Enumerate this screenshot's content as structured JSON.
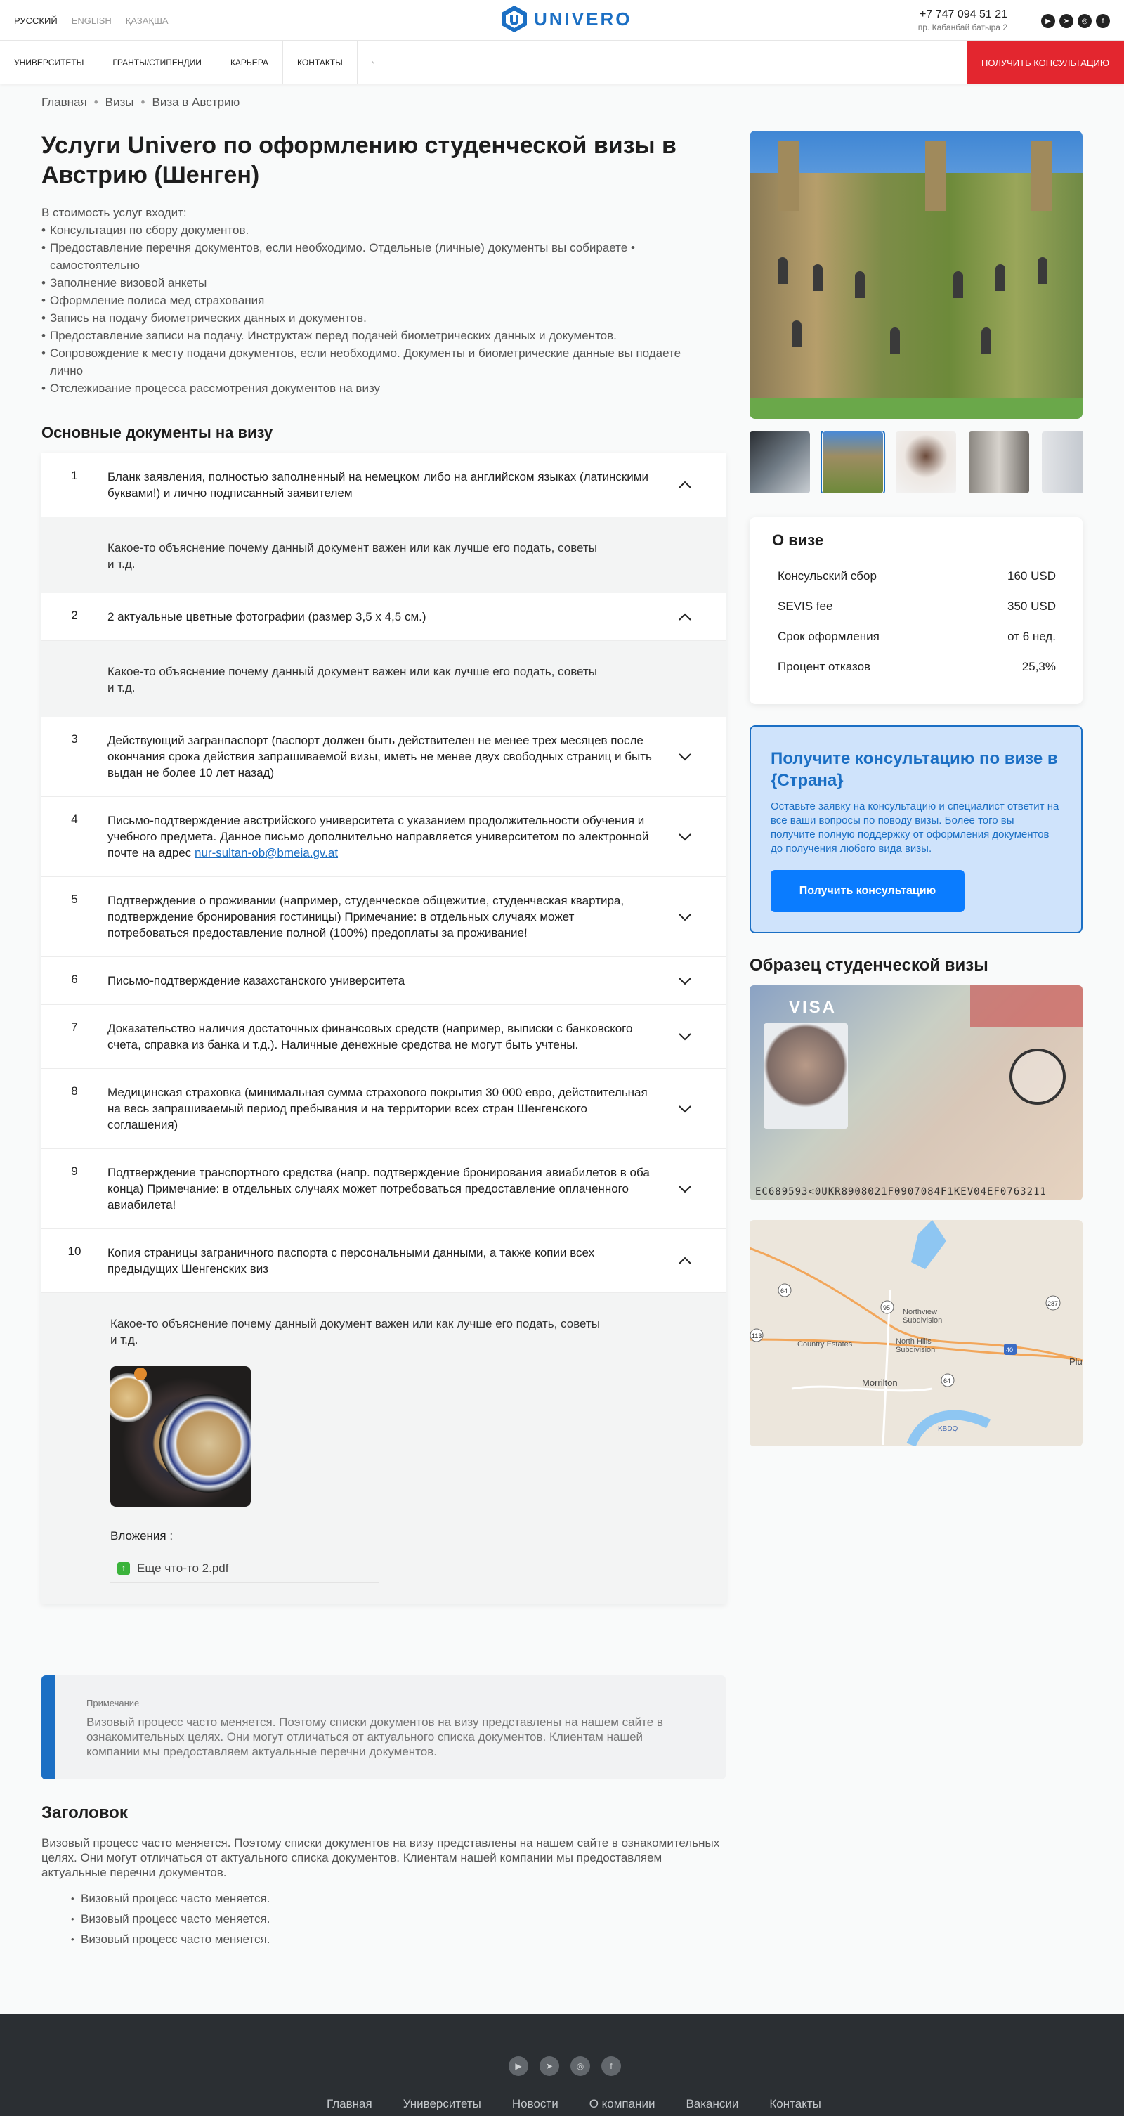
{
  "header": {
    "languages": [
      "РУССКИЙ",
      "ENGLISH",
      "ҚАЗАҚША"
    ],
    "logo_text": "UNIVERO",
    "phone": "+7 747 094 51 21",
    "address": "пр. Кабанбай батыра 2"
  },
  "nav": {
    "items": [
      "УНИВЕРСИТЕТЫ",
      "ГРАНТЫ/СТИПЕНДИИ",
      "КАРЬЕРА",
      "КОНТАКТЫ"
    ],
    "cta": "ПОЛУЧИТЬ КОНСУЛЬТАЦИЮ"
  },
  "breadcrumb": [
    "Главная",
    "Визы",
    "Виза в Австрию"
  ],
  "page": {
    "title": "Услуги Univero по оформлению студенческой визы в Австрию (Шенген)",
    "services_intro": "В стоимость услуг входит:",
    "services": [
      "Консультация по сбору документов.",
      "Предоставление перечня документов, если необходимо. Отдельные (личные) документы вы собираете • самостоятельно",
      "Заполнение визовой анкеты",
      "Оформление полиса мед страхования",
      "Запись на подачу биометрических данных и документов.",
      "Предоставление записи на подачу. Инструктаж перед подачей биометрических данных и документов.",
      "Сопровождение к месту подачи документов, если необходимо. Документы и биометрические данные вы подаете лично",
      "Отслеживание процесса рассмотрения документов на визу"
    ],
    "docs_heading": "Основные документы на визу"
  },
  "documents": [
    {
      "num": "1",
      "text": "Бланк заявления, полностью заполненный на немецком либо на английском языках (латинскими буквами!) и лично подписанный заявителем",
      "detail": "Какое-то объяснение почему данный документ важен или как лучше его подать, советы и т.д."
    },
    {
      "num": "2",
      "text": "2 актуальные цветные фотографии (размер 3,5 х 4,5 см.)",
      "detail": "Какое-то объяснение почему данный документ важен или как лучше его подать, советы и т.д."
    },
    {
      "num": "3",
      "text": "Действующий загранпаспорт (паспорт должен быть действителен не менее трех месяцев после окончания срока действия запрашиваемой визы, иметь не менее двух свободных страниц и быть выдан не более 10 лет назад)"
    },
    {
      "num": "4",
      "text": "Письмо-подтверждение австрийского университета с указанием продолжительности обучения и учебного предмета. Данное письмо дополнительно направляется университетом по электронной почте на адрес ",
      "email": "nur-sultan-ob@bmeia.gv.at"
    },
    {
      "num": "5",
      "text": "Подтверждение о проживании (например, студенческое общежитие, студенческая квартира, подтверждение бронирования гостиницы) Примечание: в отдельных случаях может потребоваться предоставление полной (100%) предоплаты за проживание!"
    },
    {
      "num": "6",
      "text": "Письмо-подтверждение казахстанского университета"
    },
    {
      "num": "7",
      "text": "Доказательство наличия достаточных финансовых средств (например, выписки с банковского счета, справка из банка и т.д.). Наличные денежные средства не могут быть учтены."
    },
    {
      "num": "8",
      "text": "Медицинская страховка (минимальная сумма страхового покрытия 30 000 евро, действительная на весь запрашиваемый период пребывания и на территории всех стран Шенгенского соглашения)"
    },
    {
      "num": "9",
      "text": "Подтверждение транспортного средства (напр. подтверждение бронирования авиабилетов в оба конца) Примечание: в отдельных случаях может потребоваться предоставление оплаченного авиабилета!"
    },
    {
      "num": "10",
      "text": "Копия страницы заграничного паспорта с персональными данными, а также копии всех предыдущих Шенгенских виз",
      "detail": "Какое-то объяснение почему данный документ важен или как лучше его подать, советы и т.д.",
      "attachments_label": "Вложения :",
      "attachment": "Еще что-то 2.pdf"
    }
  ],
  "note": {
    "label": "Примечание",
    "text": "Визовый процесс часто меняется. Поэтому списки документов на визу представлены на нашем сайте в ознакомительных целях. Они могут отличаться от актуального списка документов. Клиентам нашей компании мы предоставляем актуальные перечни документов."
  },
  "section2": {
    "heading": "Заголовок",
    "text": "Визовый процесс часто меняется. Поэтому списки документов на визу представлены на нашем сайте в ознакомительных целях. Они могут отличаться от актуального списка документов. Клиентам нашей компании мы предоставляем актуальные перечни документов.",
    "bullets": [
      "Визовый процесс часто меняется.",
      "Визовый процесс часто меняется.",
      "Визовый процесс часто меняется."
    ]
  },
  "visa_info": {
    "title": "О визе",
    "rows": [
      {
        "label": "Консульский сбор",
        "value": "160 USD"
      },
      {
        "label": "SEVIS fee",
        "value": "350 USD"
      },
      {
        "label": "Срок оформления",
        "value": "от 6 нед."
      },
      {
        "label": "Процент отказов",
        "value": "25,3%"
      }
    ]
  },
  "consult": {
    "title": "Получите консультацию по визе в {Страна}",
    "text": "Оставьте заявку на консультацию и специалист ответит на все ваши вопросы по поводу визы. Более того вы получите полную поддержку от оформления документов до получения любого вида визы.",
    "button": "Получить консультацию"
  },
  "sample": {
    "title": "Образец студенческой визы",
    "visa_word": "VISA",
    "mrz": "EC689593<0UKR8908021F0907084F1KEV04EF0763211"
  },
  "map_labels": [
    "Northview Subdivision",
    "Country Estates",
    "North Hills Subdivision",
    "Morrilton",
    "Plu",
    "KBDQ",
    "64",
    "95",
    "287",
    "113",
    "40",
    "64"
  ],
  "footer": {
    "nav": [
      "Главная",
      "Университеты",
      "Новости",
      "О компании",
      "Вакансии",
      "Контакты"
    ]
  },
  "colors": {
    "accent": "#1b6fc4",
    "cta_red": "#e3262f",
    "button_blue": "#0a7cff",
    "footer_bg": "#2b2f33"
  },
  "icons": [
    "youtube-icon",
    "telegram-icon",
    "instagram-icon",
    "facebook-icon",
    "search-icon",
    "chevron-up-icon",
    "chevron-down-icon",
    "pdf-file-icon"
  ]
}
